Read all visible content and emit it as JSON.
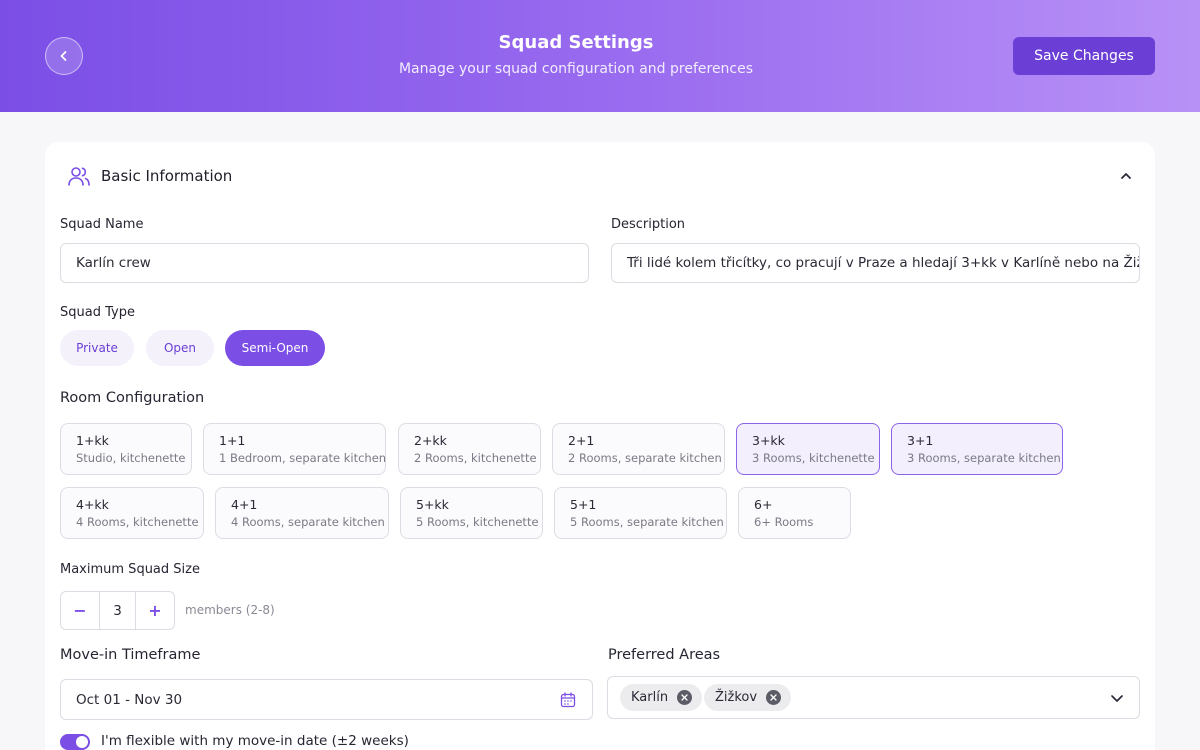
{
  "header": {
    "title": "Squad Settings",
    "subtitle": "Manage your squad configuration and preferences",
    "save_label": "Save Changes",
    "back_icon": "chevron-left-icon"
  },
  "basic_info": {
    "title": "Basic Information",
    "icon": "users-icon",
    "collapse_icon": "chevron-up-icon",
    "squad_name": {
      "label": "Squad Name",
      "value": "Karlín crew"
    },
    "description": {
      "label": "Description",
      "value": "Tři lidé kolem třicítky, co pracují v Praze a hledají 3+kk v Karlíně nebo na Žižkově c"
    },
    "squad_type": {
      "label": "Squad Type",
      "options": [
        "Private",
        "Open",
        "Semi-Open"
      ],
      "selected": "Semi-Open"
    },
    "room_configuration": {
      "label": "Room Configuration",
      "options": [
        {
          "code": "1+kk",
          "desc": "Studio, kitchenette",
          "selected": false
        },
        {
          "code": "1+1",
          "desc": "1 Bedroom, separate kitchen",
          "selected": false
        },
        {
          "code": "2+kk",
          "desc": "2 Rooms, kitchenette",
          "selected": false
        },
        {
          "code": "2+1",
          "desc": "2 Rooms, separate kitchen",
          "selected": false
        },
        {
          "code": "3+kk",
          "desc": "3 Rooms, kitchenette",
          "selected": true
        },
        {
          "code": "3+1",
          "desc": "3 Rooms, separate kitchen",
          "selected": true
        },
        {
          "code": "4+kk",
          "desc": "4 Rooms, kitchenette",
          "selected": false
        },
        {
          "code": "4+1",
          "desc": "4 Rooms, separate kitchen",
          "selected": false
        },
        {
          "code": "5+kk",
          "desc": "5 Rooms, kitchenette",
          "selected": false
        },
        {
          "code": "5+1",
          "desc": "5 Rooms, separate kitchen",
          "selected": false
        },
        {
          "code": "6+",
          "desc": "6+ Rooms",
          "selected": false
        }
      ]
    },
    "max_size": {
      "label": "Maximum Squad Size",
      "value": "3",
      "minus": "−",
      "plus": "+",
      "hint": "members (2-8)"
    },
    "move_in": {
      "label": "Move-in Timeframe",
      "value": "Oct 01 - Nov 30",
      "icon": "calendar-icon",
      "flexible_label": "I'm flexible with my move-in date (±2 weeks)",
      "flexible": true
    },
    "preferred_areas": {
      "label": "Preferred Areas",
      "chips": [
        "Karlín",
        "Žižkov"
      ],
      "dropdown_icon": "chevron-down-icon"
    }
  },
  "colors": {
    "accent": "#7b4ee6",
    "accent_dark": "#6b3fd6",
    "header_gradient_start": "#7b4ee6",
    "header_gradient_end": "#b891f6"
  }
}
